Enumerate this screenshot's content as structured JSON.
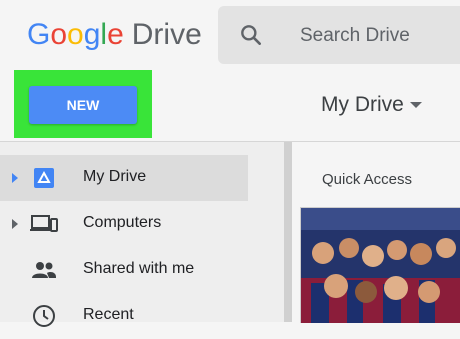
{
  "header": {
    "logo_letters": [
      "G",
      "o",
      "o",
      "g",
      "l",
      "e"
    ],
    "logo_product": "Drive",
    "search_placeholder": "Search Drive"
  },
  "toolbar": {
    "new_label": "NEW",
    "location_title": "My Drive"
  },
  "sidebar": {
    "items": [
      {
        "label": "My Drive",
        "icon": "drive-icon",
        "active": true,
        "expandable": true
      },
      {
        "label": "Computers",
        "icon": "computers-icon",
        "active": false,
        "expandable": true
      },
      {
        "label": "Shared with me",
        "icon": "people-icon",
        "active": false,
        "expandable": false
      },
      {
        "label": "Recent",
        "icon": "clock-icon",
        "active": false,
        "expandable": false
      }
    ]
  },
  "main": {
    "quick_access_label": "Quick Access"
  },
  "colors": {
    "new_button": "#4c8bf5",
    "highlight": "#39e439",
    "active_item": "#dcdcdc"
  }
}
